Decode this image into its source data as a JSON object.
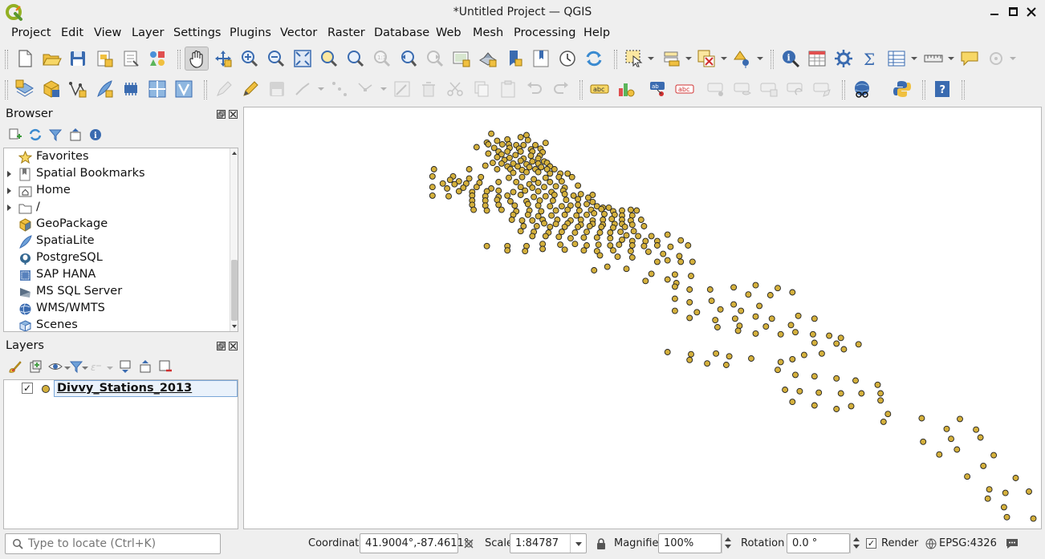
{
  "window": {
    "title": "*Untitled Project — QGIS"
  },
  "menubar": [
    "Project",
    "Edit",
    "View",
    "Layer",
    "Settings",
    "Plugins",
    "Vector",
    "Raster",
    "Database",
    "Web",
    "Mesh",
    "Processing",
    "Help"
  ],
  "browser": {
    "title": "Browser",
    "items": [
      {
        "label": "Favorites",
        "icon": "star-icon",
        "expandable": false
      },
      {
        "label": "Spatial Bookmarks",
        "icon": "bookmark-icon",
        "expandable": true
      },
      {
        "label": "Home",
        "icon": "home-folder-icon",
        "expandable": true
      },
      {
        "label": "/",
        "icon": "folder-icon",
        "expandable": true
      },
      {
        "label": "GeoPackage",
        "icon": "geopackage-icon",
        "expandable": false
      },
      {
        "label": "SpatiaLite",
        "icon": "spatialite-icon",
        "expandable": false
      },
      {
        "label": "PostgreSQL",
        "icon": "postgresql-icon",
        "expandable": false
      },
      {
        "label": "SAP HANA",
        "icon": "sap-hana-icon",
        "expandable": false
      },
      {
        "label": "MS SQL Server",
        "icon": "mssql-icon",
        "expandable": false
      },
      {
        "label": "WMS/WMTS",
        "icon": "wms-icon",
        "expandable": false
      },
      {
        "label": "Scenes",
        "icon": "scenes-icon",
        "expandable": false
      }
    ]
  },
  "layers": {
    "title": "Layers",
    "items": [
      {
        "name": "Divvy_Stations_2013",
        "visible": true,
        "symbol_color": "#d4b03c"
      }
    ]
  },
  "status": {
    "locator_placeholder": "Type to locate (Ctrl+K)",
    "coordinate_label": "Coordinate",
    "coordinate_value": "41.9004°,-87.4611°",
    "scale_label": "Scale",
    "scale_value": "1:84787",
    "magnifier_label": "Magnifier",
    "magnifier_value": "100%",
    "rotation_label": "Rotation",
    "rotation_value": "0.0 °",
    "render_label": "Render",
    "render_checked": true,
    "crs": "EPSG:4326"
  },
  "map": {
    "background": "#ffffff",
    "point_fill": "#d4b03c",
    "point_stroke": "#222222",
    "features": [
      [
        -87.57,
        42.05
      ],
      [
        -87.522,
        42.046
      ],
      [
        -87.53,
        42.04
      ],
      [
        -87.548,
        42.034
      ],
      [
        -87.52,
        42.032
      ],
      [
        -87.562,
        42.03
      ],
      [
        -87.576,
        42.025
      ],
      [
        -87.574,
        42.02
      ],
      [
        -87.555,
        42.02
      ],
      [
        -87.546,
        42.02
      ],
      [
        -87.536,
        42.018
      ],
      [
        -87.526,
        42.018
      ],
      [
        -87.51,
        42.018
      ],
      [
        -87.496,
        42.024
      ],
      [
        -87.59,
        42.012
      ],
      [
        -87.566,
        42.01
      ],
      [
        -87.545,
        42.01
      ],
      [
        -87.532,
        42.008
      ],
      [
        -87.516,
        42.006
      ],
      [
        -87.503,
        42.008
      ],
      [
        -87.56,
        42.0
      ],
      [
        -87.548,
        42.0
      ],
      [
        -87.53,
        42.0
      ],
      [
        -87.514,
        42.0
      ],
      [
        -87.5,
        41.998
      ],
      [
        -87.574,
        41.994
      ],
      [
        -87.556,
        41.992
      ],
      [
        -87.537,
        41.99
      ],
      [
        -87.516,
        41.988
      ],
      [
        -87.504,
        41.988
      ],
      [
        -87.506,
        41.98
      ],
      [
        -87.562,
        41.984
      ],
      [
        -87.545,
        41.982
      ],
      [
        -87.526,
        41.98
      ],
      [
        -87.552,
        41.976
      ],
      [
        -87.53,
        41.974
      ],
      [
        -87.514,
        41.972
      ],
      [
        -87.498,
        41.972
      ],
      [
        -87.568,
        41.968
      ],
      [
        -87.556,
        41.966
      ],
      [
        -87.54,
        41.966
      ],
      [
        -87.522,
        41.964
      ],
      [
        -87.506,
        41.966
      ],
      [
        -87.494,
        41.968
      ],
      [
        -87.578,
        41.96
      ],
      [
        -87.548,
        41.958
      ],
      [
        -87.534,
        41.958
      ],
      [
        -87.518,
        41.956
      ],
      [
        -87.502,
        41.956
      ],
      [
        -87.49,
        41.958
      ],
      [
        -87.6,
        41.95
      ],
      [
        -87.562,
        41.95
      ],
      [
        -87.544,
        41.95
      ],
      [
        -87.528,
        41.948
      ],
      [
        -87.51,
        41.95
      ],
      [
        -87.494,
        41.95
      ],
      [
        -87.484,
        41.95
      ],
      [
        -87.648,
        41.95
      ],
      [
        -87.54,
        41.94
      ],
      [
        -87.522,
        41.942
      ],
      [
        -87.506,
        41.942
      ],
      [
        -87.49,
        41.938
      ],
      [
        -87.476,
        41.938
      ],
      [
        -87.466,
        41.938
      ],
      [
        -87.65,
        41.93
      ],
      [
        -87.622,
        41.93
      ],
      [
        -87.626,
        41.92
      ],
      [
        -87.614,
        41.916
      ],
      [
        -87.6,
        41.924
      ],
      [
        -87.584,
        41.928
      ],
      [
        -87.546,
        41.926
      ],
      [
        -87.528,
        41.928
      ],
      [
        -87.512,
        41.922
      ],
      [
        -87.496,
        41.926
      ],
      [
        -87.478,
        41.928
      ],
      [
        -87.46,
        41.928
      ],
      [
        -87.636,
        41.91
      ],
      [
        -87.62,
        41.908
      ],
      [
        -87.604,
        41.91
      ],
      [
        -87.586,
        41.912
      ],
      [
        -87.56,
        41.914
      ],
      [
        -87.536,
        41.914
      ],
      [
        -87.518,
        41.908
      ],
      [
        -87.506,
        41.912
      ],
      [
        -87.49,
        41.914
      ],
      [
        -87.474,
        41.916
      ],
      [
        -87.65,
        41.9
      ],
      [
        -87.63,
        41.896
      ],
      [
        -87.608,
        41.898
      ],
      [
        -87.59,
        41.9
      ],
      [
        -87.57,
        41.896
      ],
      [
        -87.53,
        41.9
      ],
      [
        -87.514,
        41.898
      ],
      [
        -87.498,
        41.9
      ],
      [
        -87.482,
        41.902
      ],
      [
        -87.47,
        41.898
      ],
      [
        -87.452,
        41.904
      ],
      [
        -87.614,
        41.888
      ],
      [
        -87.596,
        41.886
      ],
      [
        -87.576,
        41.888
      ],
      [
        -87.56,
        41.89
      ],
      [
        -87.54,
        41.886
      ],
      [
        -87.524,
        41.89
      ],
      [
        -87.506,
        41.888
      ],
      [
        -87.488,
        41.886
      ],
      [
        -87.472,
        41.89
      ],
      [
        -87.65,
        41.876
      ],
      [
        -87.628,
        41.874
      ],
      [
        -87.596,
        41.876
      ],
      [
        -87.578,
        41.874
      ],
      [
        -87.56,
        41.872
      ],
      [
        -87.548,
        41.876
      ],
      [
        -87.53,
        41.878
      ],
      [
        -87.512,
        41.872
      ],
      [
        -87.496,
        41.874
      ],
      [
        -87.484,
        41.878
      ],
      [
        -87.47,
        41.88
      ],
      [
        -87.458,
        41.876
      ],
      [
        -87.448,
        41.88
      ],
      [
        -87.432,
        41.878
      ],
      [
        -87.596,
        41.862
      ],
      [
        -87.578,
        41.862
      ],
      [
        -87.562,
        41.864
      ],
      [
        -87.544,
        41.86
      ],
      [
        -87.522,
        41.86
      ],
      [
        -87.504,
        41.862
      ],
      [
        -87.486,
        41.862
      ],
      [
        -87.468,
        41.864
      ],
      [
        -87.452,
        41.866
      ],
      [
        -87.438,
        41.87
      ],
      [
        -87.596,
        41.85
      ],
      [
        -87.578,
        41.848
      ],
      [
        -87.56,
        41.85
      ],
      [
        -87.538,
        41.848
      ],
      [
        -87.52,
        41.852
      ],
      [
        -87.506,
        41.848
      ],
      [
        -87.49,
        41.846
      ],
      [
        -87.474,
        41.846
      ],
      [
        -87.462,
        41.848
      ],
      [
        -87.452,
        41.85
      ],
      [
        -87.44,
        41.852
      ],
      [
        -87.432,
        41.858
      ],
      [
        -87.426,
        41.846
      ],
      [
        -87.418,
        41.842
      ],
      [
        -87.41,
        41.842
      ],
      [
        -87.594,
        41.836
      ],
      [
        -87.576,
        41.834
      ],
      [
        -87.556,
        41.836
      ],
      [
        -87.536,
        41.832
      ],
      [
        -87.518,
        41.834
      ],
      [
        -87.502,
        41.832
      ],
      [
        -87.482,
        41.834
      ],
      [
        -87.466,
        41.836
      ],
      [
        -87.45,
        41.834
      ],
      [
        -87.434,
        41.836
      ],
      [
        -87.42,
        41.838
      ],
      [
        -87.404,
        41.832
      ],
      [
        -87.392,
        41.834
      ],
      [
        -87.38,
        41.836
      ],
      [
        -87.372,
        41.834
      ],
      [
        -87.54,
        41.822
      ],
      [
        -87.52,
        41.822
      ],
      [
        -87.506,
        41.818
      ],
      [
        -87.488,
        41.82
      ],
      [
        -87.47,
        41.822
      ],
      [
        -87.454,
        41.82
      ],
      [
        -87.44,
        41.822
      ],
      [
        -87.43,
        41.826
      ],
      [
        -87.416,
        41.824
      ],
      [
        -87.402,
        41.822
      ],
      [
        -87.392,
        41.82
      ],
      [
        -87.378,
        41.82
      ],
      [
        -87.542,
        41.808
      ],
      [
        -87.528,
        41.806
      ],
      [
        -87.514,
        41.806
      ],
      [
        -87.5,
        41.808
      ],
      [
        -87.48,
        41.808
      ],
      [
        -87.462,
        41.806
      ],
      [
        -87.448,
        41.808
      ],
      [
        -87.432,
        41.806
      ],
      [
        -87.418,
        41.808
      ],
      [
        -87.406,
        41.81
      ],
      [
        -87.392,
        41.808
      ],
      [
        -87.38,
        41.806
      ],
      [
        -87.366,
        41.808
      ],
      [
        -87.498,
        41.798
      ],
      [
        -87.482,
        41.796
      ],
      [
        -87.466,
        41.798
      ],
      [
        -87.448,
        41.794
      ],
      [
        -87.432,
        41.796
      ],
      [
        -87.418,
        41.794
      ],
      [
        -87.402,
        41.796
      ],
      [
        -87.392,
        41.796
      ],
      [
        -87.378,
        41.794
      ],
      [
        -87.526,
        41.79
      ],
      [
        -87.508,
        41.79
      ],
      [
        -87.49,
        41.788
      ],
      [
        -87.47,
        41.788
      ],
      [
        -87.452,
        41.788
      ],
      [
        -87.436,
        41.79
      ],
      [
        -87.42,
        41.788
      ],
      [
        -87.404,
        41.786
      ],
      [
        -87.388,
        41.788
      ],
      [
        -87.362,
        41.79
      ],
      [
        -87.53,
        41.776
      ],
      [
        -87.512,
        41.774
      ],
      [
        -87.492,
        41.772
      ],
      [
        -87.474,
        41.774
      ],
      [
        -87.456,
        41.772
      ],
      [
        -87.44,
        41.774
      ],
      [
        -87.422,
        41.772
      ],
      [
        -87.408,
        41.772
      ],
      [
        -87.394,
        41.774
      ],
      [
        -87.376,
        41.776
      ],
      [
        -87.386,
        41.764
      ],
      [
        -87.37,
        41.762
      ],
      [
        -87.352,
        41.762
      ],
      [
        -87.33,
        41.766
      ],
      [
        -87.514,
        41.762
      ],
      [
        -87.496,
        41.762
      ],
      [
        -87.478,
        41.76
      ],
      [
        -87.462,
        41.756
      ],
      [
        -87.444,
        41.758
      ],
      [
        -87.426,
        41.758
      ],
      [
        -87.408,
        41.756
      ],
      [
        -87.392,
        41.752
      ],
      [
        -87.378,
        41.748
      ],
      [
        -87.36,
        41.748
      ],
      [
        -87.344,
        41.748
      ],
      [
        -87.312,
        41.75
      ],
      [
        -87.378,
        41.736
      ],
      [
        -87.362,
        41.734
      ],
      [
        -87.344,
        41.736
      ],
      [
        -87.326,
        41.732
      ],
      [
        -87.302,
        41.736
      ],
      [
        -87.5,
        41.74
      ],
      [
        -87.476,
        41.738
      ],
      [
        -87.456,
        41.74
      ],
      [
        -87.44,
        41.736
      ],
      [
        -87.424,
        41.738
      ],
      [
        -87.408,
        41.736
      ],
      [
        -87.396,
        41.738
      ],
      [
        -87.576,
        41.734
      ],
      [
        -87.548,
        41.734
      ],
      [
        -87.522,
        41.734
      ],
      [
        -87.5,
        41.726
      ],
      [
        -87.47,
        41.724
      ],
      [
        -87.444,
        41.722
      ],
      [
        -87.426,
        41.72
      ],
      [
        -87.404,
        41.722
      ],
      [
        -87.38,
        41.72
      ],
      [
        -87.356,
        41.718
      ],
      [
        -87.336,
        41.712
      ],
      [
        -87.314,
        41.706
      ],
      [
        -87.548,
        41.722
      ],
      [
        -87.524,
        41.72
      ],
      [
        -87.422,
        41.708
      ],
      [
        -87.398,
        41.704
      ],
      [
        -87.378,
        41.702
      ],
      [
        -87.344,
        41.69
      ],
      [
        -87.33,
        41.694
      ],
      [
        -87.312,
        41.69
      ],
      [
        -87.296,
        41.69
      ],
      [
        -87.412,
        41.676
      ],
      [
        -87.386,
        41.67
      ],
      [
        -87.43,
        41.666
      ],
      [
        -87.352,
        41.656
      ],
      [
        -87.32,
        41.654
      ],
      [
        -87.298,
        41.65
      ],
      [
        -87.33,
        41.64
      ],
      [
        -87.318,
        41.63
      ],
      [
        -87.36,
        41.636
      ],
      [
        -87.32,
        41.62
      ],
      [
        -87.3,
        41.612
      ],
      [
        -87.272,
        41.612
      ],
      [
        -87.24,
        41.618
      ],
      [
        -87.21,
        41.624
      ],
      [
        -87.18,
        41.616
      ],
      [
        -87.16,
        41.604
      ],
      [
        -87.19,
        41.596
      ],
      [
        -87.22,
        41.598
      ],
      [
        -87.27,
        41.58
      ],
      [
        -87.3,
        41.576
      ],
      [
        -87.32,
        41.586
      ],
      [
        -87.24,
        41.57
      ],
      [
        -87.205,
        41.566
      ],
      [
        -87.23,
        41.552
      ],
      [
        -87.258,
        41.556
      ],
      [
        -87.29,
        41.548
      ],
      [
        -87.32,
        41.552
      ],
      [
        -87.3,
        41.532
      ],
      [
        -87.265,
        41.526
      ],
      [
        -87.238,
        41.53
      ],
      [
        -87.21,
        41.536
      ],
      [
        -87.188,
        41.53
      ],
      [
        -87.152,
        41.538
      ],
      [
        -87.13,
        41.53
      ],
      [
        -87.162,
        41.512
      ],
      [
        -87.196,
        41.508
      ],
      [
        -87.232,
        41.51
      ],
      [
        -87.262,
        41.506
      ],
      [
        -87.21,
        41.488
      ],
      [
        -87.234,
        41.496
      ],
      [
        -87.176,
        41.486
      ],
      [
        -87.156,
        41.492
      ],
      [
        -87.132,
        41.486
      ],
      [
        -87.11,
        41.482
      ],
      [
        -87.094,
        41.476
      ],
      [
        -87.13,
        41.462
      ],
      [
        -87.1,
        41.46
      ],
      [
        -87.07,
        41.458
      ],
      [
        -87.09,
        41.444
      ],
      [
        -87.12,
        41.432
      ],
      [
        -87.144,
        41.428
      ],
      [
        -87.16,
        41.416
      ],
      [
        -87.176,
        41.408
      ],
      [
        -87.216,
        41.418
      ],
      [
        -87.246,
        41.424
      ],
      [
        -87.264,
        41.432
      ],
      [
        -87.298,
        41.43
      ],
      [
        -87.33,
        41.436
      ],
      [
        -87.3,
        41.414
      ],
      [
        -87.276,
        41.404
      ],
      [
        -87.25,
        41.4
      ],
      [
        -87.18,
        41.386
      ],
      [
        -87.156,
        41.372
      ],
      [
        -87.13,
        41.368
      ],
      [
        -87.1,
        41.362
      ],
      [
        -87.074,
        41.356
      ],
      [
        -87.044,
        41.344
      ],
      [
        -87.04,
        41.32
      ],
      [
        -87.066,
        41.32
      ],
      [
        -87.094,
        41.32
      ],
      [
        -87.124,
        41.322
      ],
      [
        -87.15,
        41.326
      ],
      [
        -87.17,
        41.33
      ],
      [
        -87.04,
        41.3
      ],
      [
        -87.08,
        41.284
      ],
      [
        -87.1,
        41.276
      ],
      [
        -87.13,
        41.286
      ],
      [
        -87.16,
        41.296
      ],
      [
        -87.03,
        41.262
      ],
      [
        -87.036,
        41.24
      ],
      [
        -86.984,
        41.25
      ],
      [
        -86.932,
        41.248
      ],
      [
        -86.95,
        41.22
      ],
      [
        -86.91,
        41.218
      ],
      [
        -86.904,
        41.196
      ],
      [
        -86.944,
        41.192
      ],
      [
        -86.982,
        41.184
      ],
      [
        -86.936,
        41.162
      ],
      [
        -86.96,
        41.148
      ],
      [
        -86.886,
        41.146
      ],
      [
        -86.9,
        41.116
      ],
      [
        -86.922,
        41.086
      ],
      [
        -86.856,
        41.082
      ],
      [
        -86.892,
        41.05
      ],
      [
        -86.87,
        41.04
      ],
      [
        -86.838,
        41.044
      ],
      [
        -86.894,
        41.024
      ],
      [
        -86.872,
        41.0
      ],
      [
        -86.868,
        40.972
      ],
      [
        -86.832,
        40.968
      ],
      [
        -86.816,
        40.956
      ],
      [
        -86.796,
        40.968
      ],
      [
        -86.858,
        40.93
      ]
    ]
  }
}
